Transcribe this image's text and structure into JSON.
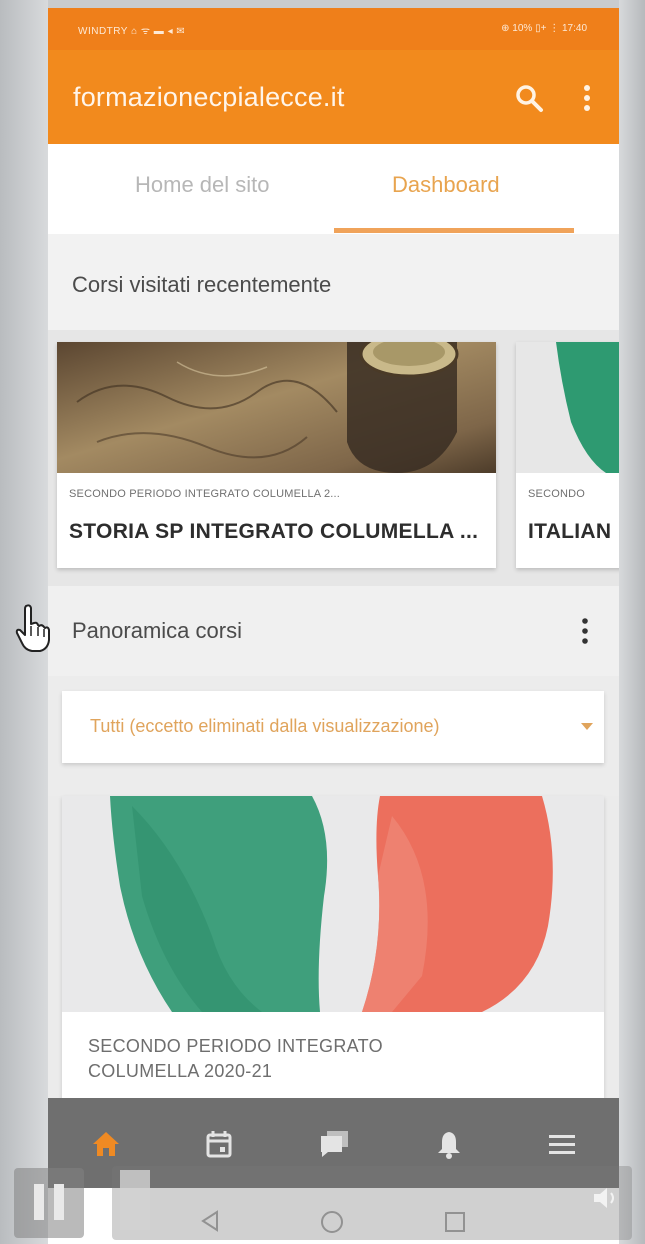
{
  "status_bar": {
    "left": "WINDTRY ⌂ ᯤ ▬ ◂ ✉",
    "right": "⊕ 10% ▯+ ⋮ 17:40"
  },
  "app_bar": {
    "title": "formazionecpialecce.it",
    "search_icon": "search-icon",
    "menu_icon": "more-vert-icon"
  },
  "tabs": [
    {
      "label": "Home del sito",
      "active": false
    },
    {
      "label": "Dashboard",
      "active": true
    }
  ],
  "recent": {
    "heading": "Corsi visitati recentemente",
    "cards": [
      {
        "category": "SECONDO PERIODO INTEGRATO COLUMELLA 2...",
        "name": "STORIA SP INTEGRATO COLUMELLA ..."
      },
      {
        "category": "SECONDO",
        "name": "ITALIAN"
      }
    ]
  },
  "overview": {
    "heading": "Panoramica corsi",
    "filter_label": "Tutti (eccetto eliminati dalla visualizzazione)",
    "course": {
      "category": "SECONDO PERIODO INTEGRATO COLUMELLA 2020-21"
    }
  },
  "bottom_nav": [
    {
      "name": "home-icon",
      "active": true
    },
    {
      "name": "calendar-icon",
      "active": false
    },
    {
      "name": "messages-icon",
      "active": false
    },
    {
      "name": "notifications-icon",
      "active": false
    },
    {
      "name": "menu-icon",
      "active": false
    }
  ],
  "colors": {
    "accent": "#f28a1d",
    "active_tab": "#e8a44f",
    "nav_bar": "#6f6f6f"
  }
}
